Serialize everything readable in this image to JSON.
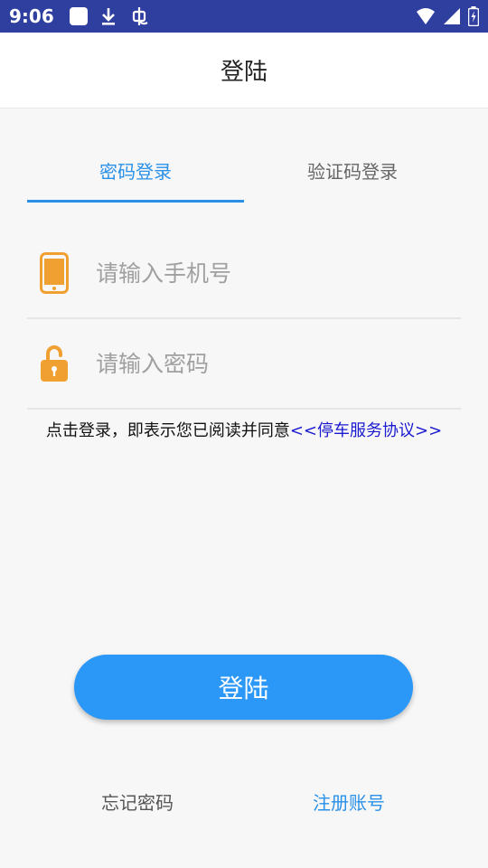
{
  "status_bar": {
    "time": "9:06"
  },
  "header": {
    "title": "登陆"
  },
  "tabs": [
    {
      "label": "密码登录",
      "active": true
    },
    {
      "label": "验证码登录",
      "active": false
    }
  ],
  "form": {
    "phone": {
      "placeholder": "请输入手机号",
      "value": "",
      "icon": "smartphone-icon"
    },
    "password": {
      "placeholder": "请输入密码",
      "value": "",
      "icon": "unlock-icon"
    }
  },
  "agreement": {
    "text": "点击登录，即表示您已阅读并同意",
    "link": "<<停车服务协议>>"
  },
  "login_button": {
    "label": "登陆"
  },
  "links": {
    "forgot_password": "忘记密码",
    "register": "注册账号"
  },
  "colors": {
    "status_bar": "#2f3fa0",
    "accent": "#2a90e8",
    "button": "#2b97f6",
    "icon": "#f0a030",
    "agreement_link": "#1a1ad0"
  }
}
